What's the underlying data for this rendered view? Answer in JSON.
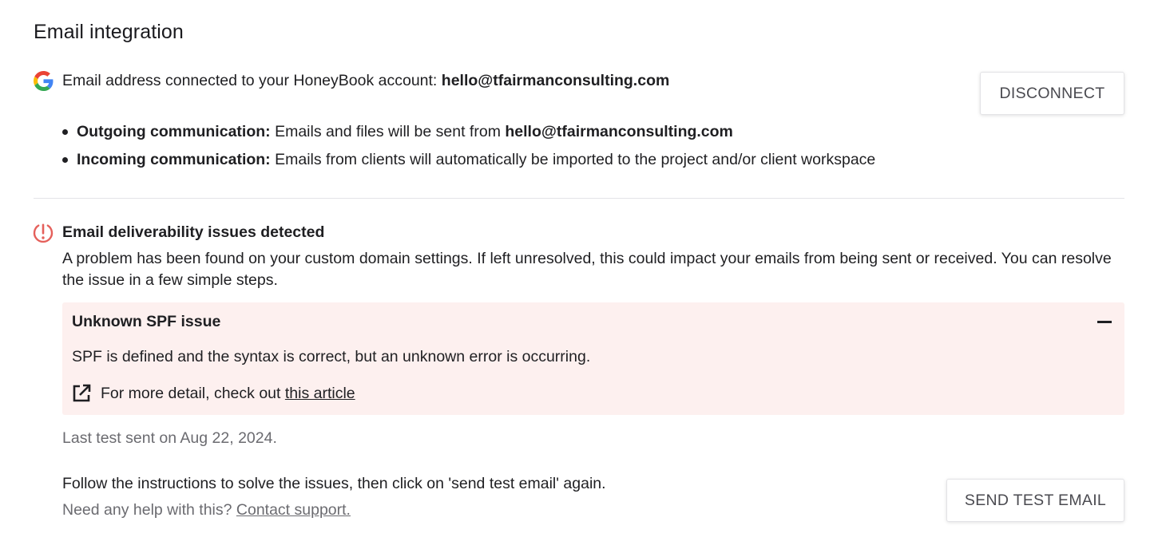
{
  "integration": {
    "title": "Email integration",
    "connected_label": "Email address connected to your HoneyBook account:",
    "connected_email": "hello@tfairmanconsulting.com",
    "disconnect_label": "DISCONNECT",
    "google_icon": "google-g-icon"
  },
  "bullets": [
    {
      "label": "Outgoing communication:",
      "text": "Emails and files will be sent from",
      "email": "hello@tfairmanconsulting.com"
    },
    {
      "label": "Incoming communication:",
      "text": "Emails from clients will automatically be imported to the project and/or client workspace"
    }
  ],
  "deliverability": {
    "title": "Email deliverability issues detected",
    "description": "A problem has been found on your custom domain settings. If left unresolved, this could impact your emails from being sent or received. You can resolve the issue in a few simple steps.",
    "alert_icon": "alert-circle-icon",
    "alert_color": "#e5605b",
    "issue": {
      "title": "Unknown SPF issue",
      "text": "SPF is defined and the syntax is correct, but an unknown error is occurring.",
      "detail_prefix": "For more detail, check out",
      "detail_link": "this article",
      "background": "#fdf0ef"
    },
    "last_test": "Last test sent on Aug 22, 2024.",
    "instructions": "Follow the instructions to solve the issues, then click on 'send test email' again.",
    "help_prefix": "Need any help with this?",
    "help_link": "Contact support.",
    "send_test_label": "SEND TEST EMAIL"
  }
}
